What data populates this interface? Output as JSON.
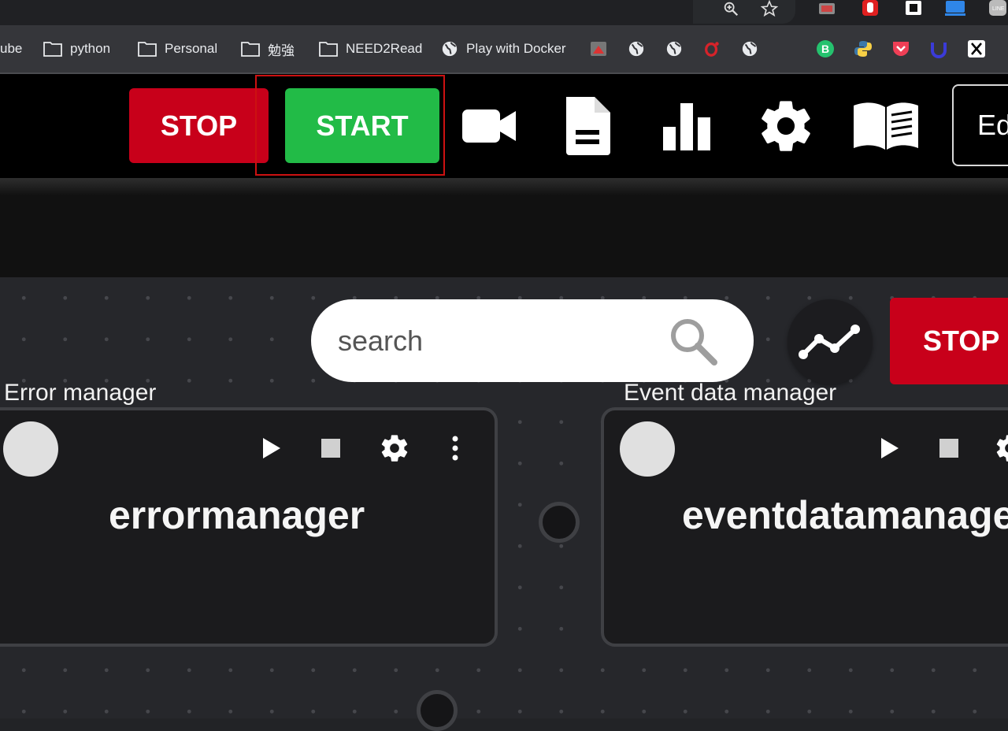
{
  "browser": {
    "bookmarks": [
      {
        "label": "ube",
        "type": "text"
      },
      {
        "label": "python",
        "type": "folder"
      },
      {
        "label": "Personal",
        "type": "folder"
      },
      {
        "label": "勉強",
        "type": "folder"
      },
      {
        "label": "NEED2Read",
        "type": "folder"
      },
      {
        "label": "Play with Docker",
        "type": "globe"
      }
    ],
    "icons": [
      "zoom-icon",
      "star-icon",
      "extension-icon",
      "pocket-icon",
      "x-icon"
    ]
  },
  "toolbar": {
    "stop_label": "STOP",
    "start_label": "START",
    "edit_label": "Ed",
    "icons": [
      "video-camera-icon",
      "document-icon",
      "bar-chart-icon",
      "gear-icon",
      "book-icon"
    ]
  },
  "canvas": {
    "search_placeholder": "search",
    "stop_label": "STOP",
    "nodes": [
      {
        "title": "Error manager",
        "name": "errormanager"
      },
      {
        "title": "Event data manager",
        "name": "eventdatamanager"
      }
    ]
  },
  "colors": {
    "stop": "#c8001a",
    "start": "#22bb47",
    "toolbar_bg": "#000000",
    "canvas_bg": "#26272b"
  }
}
